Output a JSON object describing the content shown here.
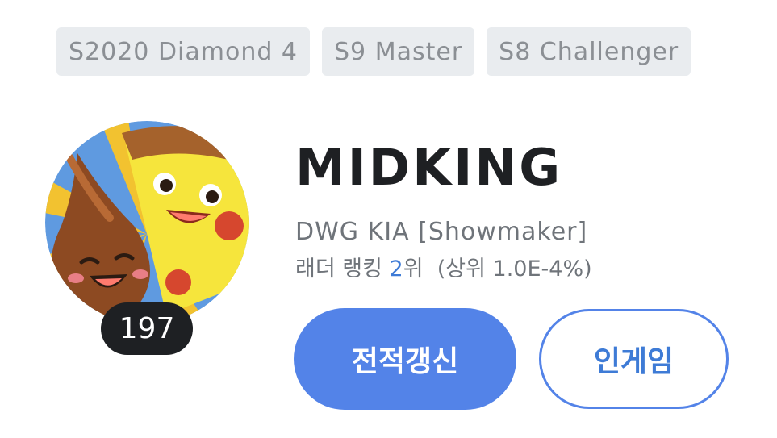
{
  "past_tiers": [
    {
      "season": "S2020",
      "tier": "Diamond 4"
    },
    {
      "season": "S9",
      "tier": "Master"
    },
    {
      "season": "S8",
      "tier": "Challenger"
    }
  ],
  "profile": {
    "level": "197",
    "summoner_name": "MIDKING",
    "team": "DWG KIA [Showmaker]",
    "ladder": {
      "prefix": "래더 랭킹",
      "rank": "2",
      "rank_suffix": "위",
      "top_percent": "(상위 1.0E-4%)"
    }
  },
  "buttons": {
    "renew": "전적갱신",
    "ingame": "인게임"
  },
  "colors": {
    "accent": "#5383e8",
    "rank_text": "#3e7bd6",
    "tier_badge_bg": "#e9ecef",
    "level_badge_bg": "#1e2023"
  },
  "avatar": {
    "icon": "profile-icon-pizza-and-chocolate"
  }
}
